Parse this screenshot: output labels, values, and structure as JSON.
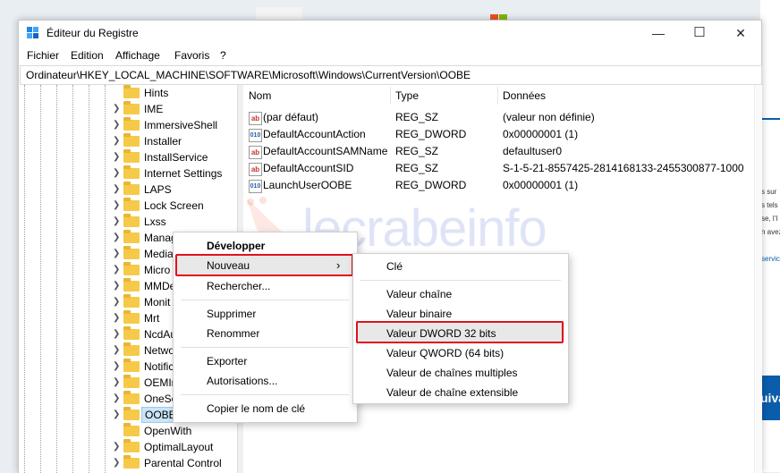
{
  "window": {
    "title": "Éditeur du Registre",
    "minimize": "—",
    "maximize": "☐",
    "close": "✕"
  },
  "menu": [
    "Fichier",
    "Edition",
    "Affichage",
    "Favoris",
    "?"
  ],
  "address": "Ordinateur\\HKEY_LOCAL_MACHINE\\SOFTWARE\\Microsoft\\Windows\\CurrentVersion\\OOBE",
  "tree": [
    {
      "label": "Hints"
    },
    {
      "label": "IME"
    },
    {
      "label": "ImmersiveShell"
    },
    {
      "label": "Installer"
    },
    {
      "label": "InstallService"
    },
    {
      "label": "Internet Settings"
    },
    {
      "label": "LAPS"
    },
    {
      "label": "Lock Screen"
    },
    {
      "label": "Lxss"
    },
    {
      "label": "Manag"
    },
    {
      "label": "Media"
    },
    {
      "label": "Micro"
    },
    {
      "label": "MMDe"
    },
    {
      "label": "Monit"
    },
    {
      "label": "Mrt"
    },
    {
      "label": "NcdAu"
    },
    {
      "label": "Netwo"
    },
    {
      "label": "Notific"
    },
    {
      "label": "OEMIr"
    },
    {
      "label": "OneSe"
    },
    {
      "label": "OOBE"
    },
    {
      "label": "OpenWith"
    },
    {
      "label": "OptimalLayout"
    },
    {
      "label": "Parental Control"
    }
  ],
  "columns": {
    "name": "Nom",
    "type": "Type",
    "data": "Données"
  },
  "values": [
    {
      "icon": "ab",
      "name": "(par défaut)",
      "type": "REG_SZ",
      "data": "(valeur non définie)"
    },
    {
      "icon": "010",
      "name": "DefaultAccountAction",
      "type": "REG_DWORD",
      "data": "0x00000001 (1)"
    },
    {
      "icon": "ab",
      "name": "DefaultAccountSAMName",
      "type": "REG_SZ",
      "data": "defaultuser0"
    },
    {
      "icon": "ab",
      "name": "DefaultAccountSID",
      "type": "REG_SZ",
      "data": "S-1-5-21-8557425-2814168133-2455300877-1000"
    },
    {
      "icon": "010",
      "name": "LaunchUserOOBE",
      "type": "REG_DWORD",
      "data": "0x00000001 (1)"
    }
  ],
  "context_menu": {
    "develop": "Développer",
    "new": "Nouveau",
    "search": "Rechercher...",
    "delete": "Supprimer",
    "rename": "Renommer",
    "export": "Exporter",
    "permissions": "Autorisations...",
    "copy_key": "Copier le nom de clé"
  },
  "submenu": {
    "key": "Clé",
    "string": "Valeur chaîne",
    "binary": "Valeur binaire",
    "dword": "Valeur DWORD 32 bits",
    "qword": "Valeur QWORD (64 bits)",
    "multi": "Valeur de chaînes multiples",
    "expand": "Valeur de chaîne extensible"
  },
  "watermark": "lecrabeinfo",
  "background": {
    "snippets": [
      "s sur",
      "s tels",
      "se, l'I",
      "n avez",
      "servic"
    ],
    "button": "uiva"
  },
  "colors": {
    "highlight": "#e0121d",
    "folder": "#f7c948",
    "selection": "#cce4f7",
    "accent": "#0a5dab"
  }
}
